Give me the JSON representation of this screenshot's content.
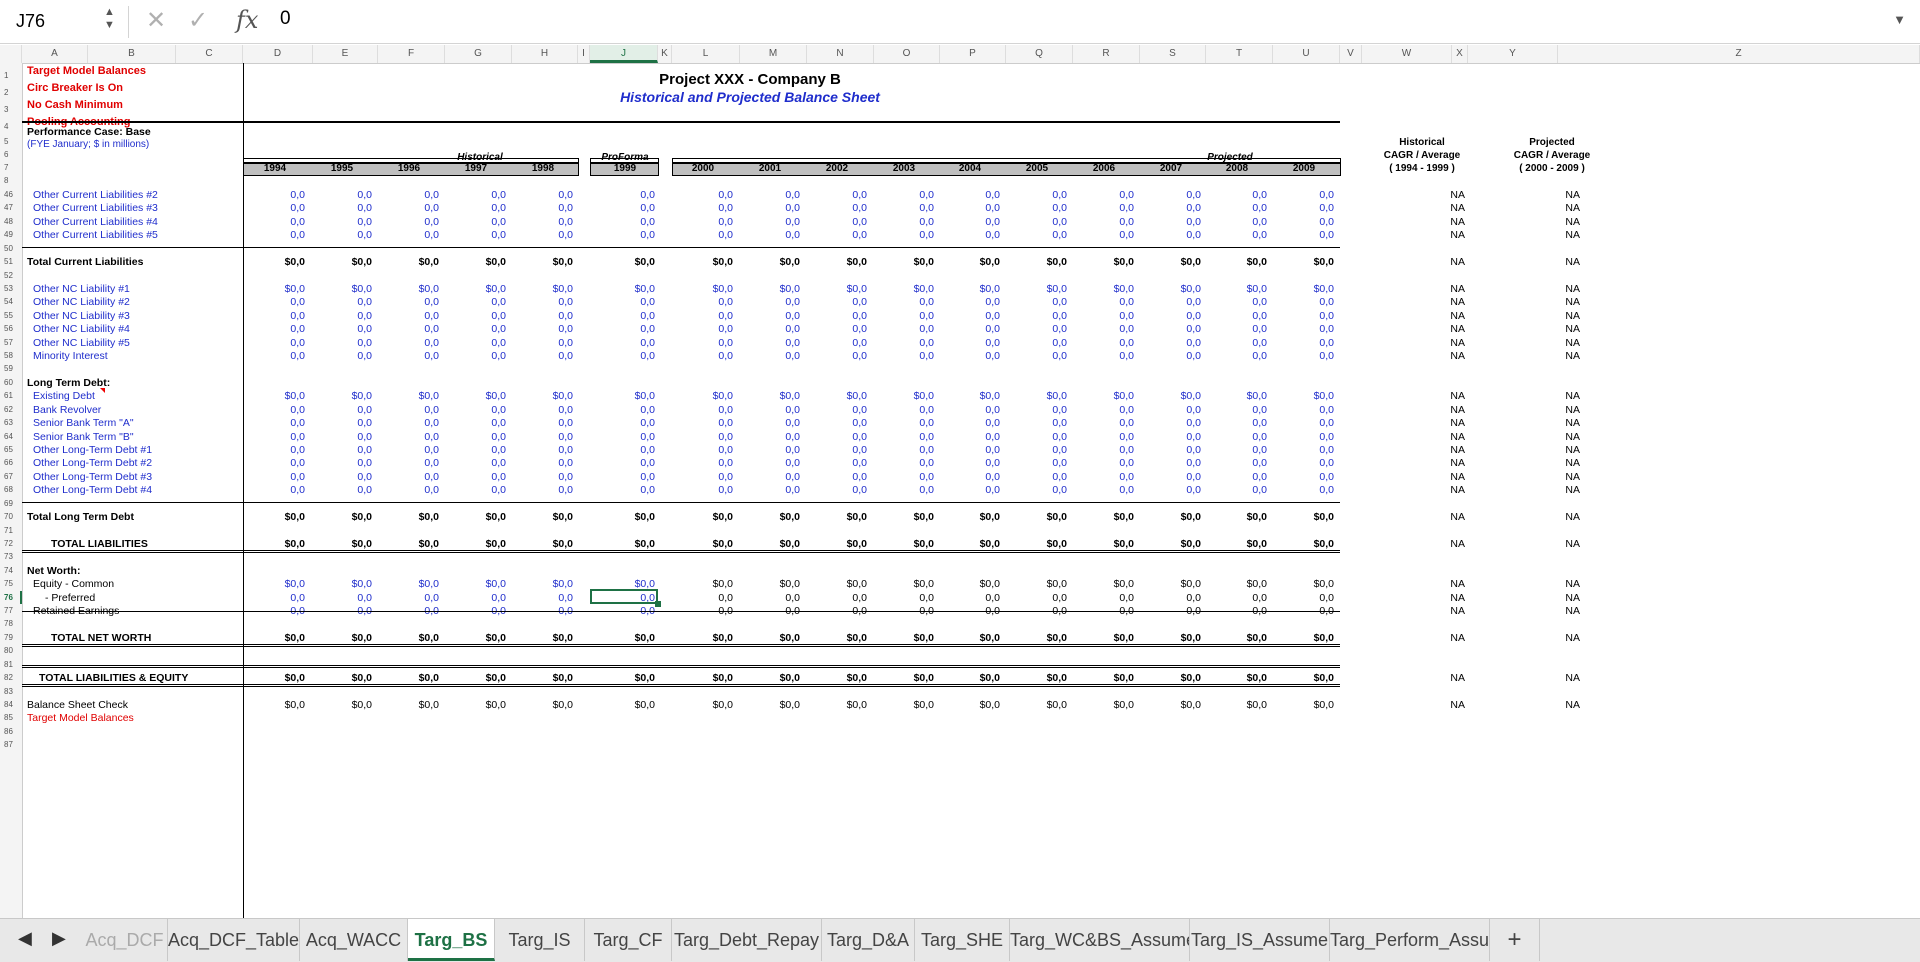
{
  "formula_bar": {
    "name_box": "J76",
    "cancel": "✕",
    "confirm": "✓",
    "fx": "fx",
    "formula": "0"
  },
  "columns": [
    "A",
    "B",
    "C",
    "D",
    "E",
    "F",
    "G",
    "H",
    "I",
    "J",
    "K",
    "L",
    "M",
    "N",
    "O",
    "P",
    "Q",
    "R",
    "S",
    "T",
    "U",
    "V",
    "W",
    "X",
    "Y",
    "Z"
  ],
  "selected_column": "J",
  "rows": [
    "1",
    "2",
    "3",
    "4",
    "5",
    "6",
    "7",
    "8",
    "46",
    "47",
    "48",
    "49",
    "50",
    "51",
    "52",
    "53",
    "54",
    "55",
    "56",
    "57",
    "58",
    "59",
    "60",
    "61",
    "62",
    "63",
    "64",
    "65",
    "66",
    "67",
    "68",
    "69",
    "70",
    "71",
    "72",
    "73",
    "74",
    "75",
    "76",
    "77",
    "78",
    "79",
    "80",
    "81",
    "82",
    "83",
    "84",
    "85",
    "86",
    "87"
  ],
  "selected_row": "76",
  "header": {
    "flags": [
      "Target Model Balances",
      "Circ Breaker Is On",
      "No Cash Minimum",
      "Pooling Accounting"
    ],
    "title": "Project XXX - Company B",
    "subtitle": "Historical and Projected Balance Sheet",
    "case": "Performance Case: Base",
    "fye": "(FYE January; $ in millions)",
    "group_historical": "Historical",
    "group_proforma": "ProForma",
    "group_projected": "Projected",
    "cagr_hist": [
      "Historical",
      "CAGR / Average",
      "( 1994 - 1999 )"
    ],
    "cagr_proj": [
      "Projected",
      "CAGR / Average",
      "( 2000 - 2009 )"
    ],
    "years": [
      "1994",
      "1995",
      "1996",
      "1997",
      "1998",
      "1999",
      "2000",
      "2001",
      "2002",
      "2003",
      "2004",
      "2005",
      "2006",
      "2007",
      "2008",
      "2009"
    ]
  },
  "body_rows": [
    {
      "row": "46",
      "label": "Other Current Liabilities #2",
      "indent": 1,
      "blue": true,
      "kind": "num"
    },
    {
      "row": "47",
      "label": "Other Current Liabilities #3",
      "indent": 1,
      "blue": true,
      "kind": "num"
    },
    {
      "row": "48",
      "label": "Other Current Liabilities #4",
      "indent": 1,
      "blue": true,
      "kind": "num"
    },
    {
      "row": "49",
      "label": "Other Current Liabilities #5",
      "indent": 1,
      "blue": true,
      "kind": "num"
    },
    {
      "row": "50",
      "kind": "blank",
      "line_after": "single"
    },
    {
      "row": "51",
      "label": "Total Current Liabilities",
      "bold": true,
      "kind": "dollar"
    },
    {
      "row": "52",
      "kind": "blank"
    },
    {
      "row": "53",
      "label": "Other NC Liability #1",
      "indent": 1,
      "blue": true,
      "kind": "dollar"
    },
    {
      "row": "54",
      "label": "Other NC Liability #2",
      "indent": 1,
      "blue": true,
      "kind": "num"
    },
    {
      "row": "55",
      "label": "Other NC Liability #3",
      "indent": 1,
      "blue": true,
      "kind": "num"
    },
    {
      "row": "56",
      "label": "Other NC Liability #4",
      "indent": 1,
      "blue": true,
      "kind": "num"
    },
    {
      "row": "57",
      "label": "Other NC Liability #5",
      "indent": 1,
      "blue": true,
      "kind": "num"
    },
    {
      "row": "58",
      "label": "Minority Interest",
      "indent": 1,
      "blue": true,
      "kind": "num"
    },
    {
      "row": "59",
      "kind": "blank"
    },
    {
      "row": "60",
      "label": "Long Term Debt:",
      "bold": true,
      "kind": "label"
    },
    {
      "row": "61",
      "label": "Existing Debt",
      "indent": 1,
      "blue": true,
      "kind": "dollar",
      "comment": true
    },
    {
      "row": "62",
      "label": "Bank Revolver",
      "indent": 1,
      "blue": true,
      "kind": "num"
    },
    {
      "row": "63",
      "label": "Senior Bank Term \"A\"",
      "indent": 1,
      "blue": true,
      "kind": "num"
    },
    {
      "row": "64",
      "label": "Senior Bank Term \"B\"",
      "indent": 1,
      "blue": true,
      "kind": "num"
    },
    {
      "row": "65",
      "label": "Other Long-Term Debt #1",
      "indent": 1,
      "blue": true,
      "kind": "num"
    },
    {
      "row": "66",
      "label": "Other Long-Term Debt #2",
      "indent": 1,
      "blue": true,
      "kind": "num"
    },
    {
      "row": "67",
      "label": "Other Long-Term Debt #3",
      "indent": 1,
      "blue": true,
      "kind": "num"
    },
    {
      "row": "68",
      "label": "Other Long-Term Debt #4",
      "indent": 1,
      "blue": true,
      "kind": "num"
    },
    {
      "row": "69",
      "kind": "blank",
      "line_after": "single"
    },
    {
      "row": "70",
      "label": "Total Long Term Debt",
      "bold": true,
      "kind": "dollar"
    },
    {
      "row": "71",
      "kind": "blank"
    },
    {
      "row": "72",
      "label": "TOTAL LIABILITIES",
      "bold": true,
      "indent": 4,
      "kind": "dollar",
      "line_after": "double"
    },
    {
      "row": "73",
      "kind": "blank"
    },
    {
      "row": "74",
      "label": "Net Worth:",
      "bold": true,
      "kind": "label"
    },
    {
      "row": "75",
      "label": "Equity  - Common",
      "indent": 1,
      "kind": "dollar",
      "blue_values": true
    },
    {
      "row": "76",
      "label": "- Preferred",
      "indent": 3,
      "kind": "num",
      "blue_values": true
    },
    {
      "row": "77",
      "label": "Retained Earnings",
      "indent": 1,
      "kind": "num",
      "blue_values": true
    },
    {
      "row": "78",
      "kind": "blank",
      "line_before": "single"
    },
    {
      "row": "79",
      "label": "TOTAL NET WORTH",
      "bold": true,
      "indent": 4,
      "kind": "dollar",
      "line_after": "double"
    },
    {
      "row": "80",
      "kind": "blank"
    },
    {
      "row": "81",
      "kind": "blank"
    },
    {
      "row": "82",
      "label": "TOTAL LIABILITIES & EQUITY",
      "bold": true,
      "indent": 2,
      "kind": "dollar",
      "line_before": "double",
      "line_after": "double"
    },
    {
      "row": "83",
      "kind": "blank"
    },
    {
      "row": "84",
      "label": "Balance Sheet Check",
      "kind": "dollar",
      "plain": true
    },
    {
      "row": "85",
      "label": "Target Model Balances",
      "red": true,
      "kind": "label"
    },
    {
      "row": "86",
      "kind": "blank"
    },
    {
      "row": "87",
      "kind": "blank"
    }
  ],
  "values": {
    "num": "0,0",
    "dollar": "$0,0",
    "na": "NA"
  },
  "active_cell": {
    "col": "J",
    "row": "76"
  },
  "tabs": [
    "Acq_DCF",
    "Acq_DCF_Table",
    "Acq_WACC",
    "Targ_BS",
    "Targ_IS",
    "Targ_CF",
    "Targ_Debt_Repay",
    "Targ_D&A",
    "Targ_SHE",
    "Targ_WC&BS_Assume",
    "Targ_IS_Assume",
    "Targ_Perform_Assu"
  ],
  "active_tab": "Targ_BS",
  "add_sheet": "+",
  "nav_prev": "◀",
  "nav_next": "▶"
}
